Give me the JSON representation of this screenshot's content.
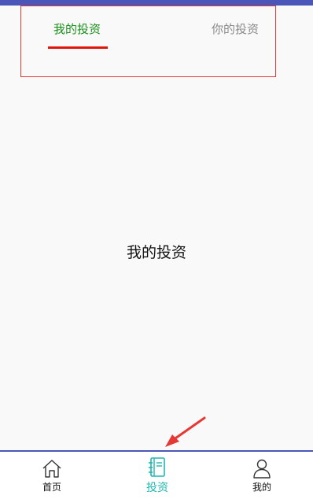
{
  "tabs": {
    "active_label": "我的投资",
    "inactive_label": "你的投资"
  },
  "main": {
    "content_text": "我的投资"
  },
  "bottom_nav": {
    "items": [
      {
        "label": "首页",
        "icon": "home-icon"
      },
      {
        "label": "投资",
        "icon": "notebook-icon",
        "active": true
      },
      {
        "label": "我的",
        "icon": "user-icon"
      }
    ]
  },
  "colors": {
    "bar_accent": "#4b57b8",
    "active_tab": "#1b8f1b",
    "tab_indicator": "#e0150c",
    "active_nav": "#1fb7b2",
    "annotation": "#e53935"
  }
}
